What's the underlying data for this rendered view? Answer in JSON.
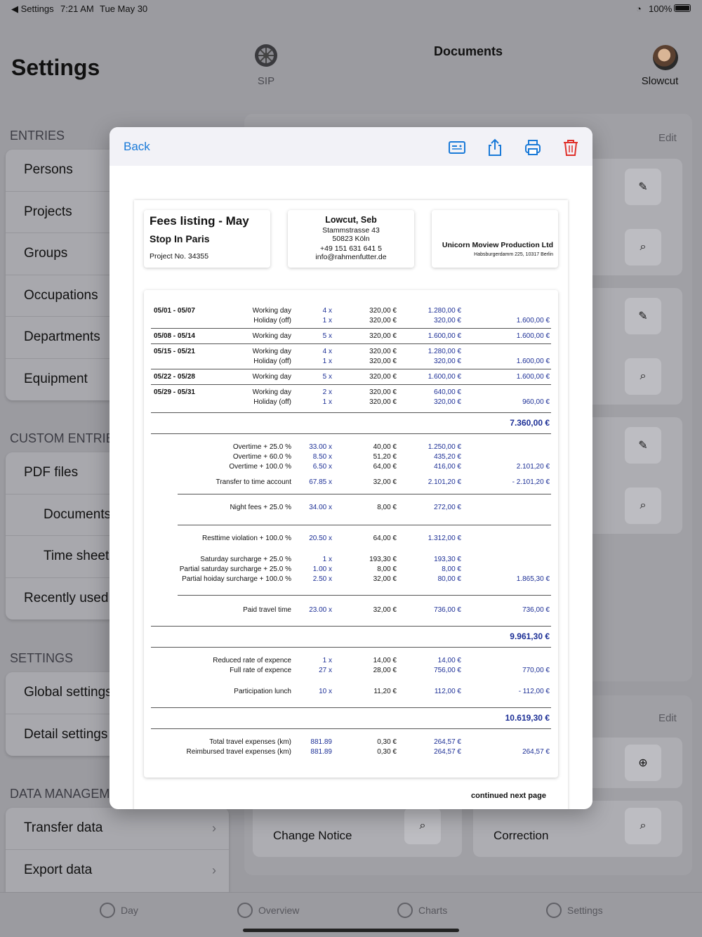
{
  "status": {
    "back_app": "◀ Settings",
    "time": "7:21 AM",
    "date": "Tue May 30",
    "battery": "100%"
  },
  "sidebar": {
    "title": "Settings",
    "sections": [
      {
        "header": "ENTRIES",
        "items": [
          "Persons",
          "Projects",
          "Groups",
          "Occupations",
          "Departments",
          "Equipment"
        ]
      },
      {
        "header": "CUSTOM ENTRIES",
        "items": [
          "PDF files",
          "Documents",
          "Time sheets",
          "Recently used"
        ]
      },
      {
        "header": "SETTINGS",
        "items": [
          "Global settings",
          "Detail settings"
        ]
      },
      {
        "header": "DATA MANAGEMEN",
        "items": [
          "Transfer data",
          "Export data"
        ]
      }
    ]
  },
  "header": {
    "project_label": "SIP",
    "title": "Documents",
    "user_label": "Slowcut"
  },
  "background": {
    "edit1": "Edit",
    "edit2": "Edit",
    "card_change": "Change Notice",
    "card_correction": "Correction"
  },
  "tabbar": {
    "day": "Day",
    "overview": "Overview",
    "charts": "Charts",
    "settings": "Settings"
  },
  "modal": {
    "back": "Back",
    "doc": {
      "title": "Fees listing - May",
      "project": "Stop In Paris",
      "project_no": "Project No. 34355",
      "person_name": "Lowcut, Seb",
      "person_street": "Stammstrasse 43",
      "person_city": "50823 Köln",
      "person_phone": "+49 151 631 641 5",
      "person_email": "info@rahmenfutter.de",
      "company": "Unicorn Moview Production Ltd",
      "company_addr": "Habsburgerdamm 225, 10317 Berlin",
      "weeks": [
        {
          "period": "05/01 - 05/07",
          "lines": [
            [
              "Working day",
              "4 x",
              "320,00 €",
              "1.280,00 €",
              ""
            ],
            [
              "Holiday (off)",
              "1 x",
              "320,00 €",
              "320,00 €",
              "1.600,00 €"
            ]
          ]
        },
        {
          "period": "05/08 - 05/14",
          "lines": [
            [
              "Working day",
              "5 x",
              "320,00 €",
              "1.600,00 €",
              "1.600,00 €"
            ]
          ]
        },
        {
          "period": "05/15 - 05/21",
          "lines": [
            [
              "Working day",
              "4 x",
              "320,00 €",
              "1.280,00 €",
              ""
            ],
            [
              "Holiday (off)",
              "1 x",
              "320,00 €",
              "320,00 €",
              "1.600,00 €"
            ]
          ]
        },
        {
          "period": "05/22 - 05/28",
          "lines": [
            [
              "Working day",
              "5 x",
              "320,00 €",
              "1.600,00 €",
              "1.600,00 €"
            ]
          ]
        },
        {
          "period": "05/29 - 05/31",
          "lines": [
            [
              "Working day",
              "2 x",
              "320,00 €",
              "640,00 €",
              ""
            ],
            [
              "Holiday (off)",
              "1 x",
              "320,00 €",
              "320,00 €",
              "960,00 €"
            ]
          ]
        }
      ],
      "subtotal1": "7.360,00 €",
      "extras": [
        [
          "Overtime + 25.0 %",
          "33.00 x",
          "40,00 €",
          "1.250,00 €",
          ""
        ],
        [
          "Overtime + 60.0 %",
          "8.50 x",
          "51,20 €",
          "435,20 €",
          ""
        ],
        [
          "Overtime + 100.0 %",
          "6.50 x",
          "64,00 €",
          "416,00 €",
          "2.101,20 €"
        ],
        [
          "Transfer to time account",
          "67.85 x",
          "32,00 €",
          "2.101,20 €",
          "- 2.101,20 €"
        ],
        [
          "Night fees + 25.0 %",
          "34.00 x",
          "8,00 €",
          "272,00 €",
          ""
        ],
        [
          "Resttime violation + 100.0 %",
          "20.50 x",
          "64,00 €",
          "1.312,00 €",
          ""
        ],
        [
          "Saturday surcharge + 25.0 %",
          "1 x",
          "193,30 €",
          "193,30 €",
          ""
        ],
        [
          "Partial saturday surcharge + 25.0 %",
          "1.00 x",
          "8,00 €",
          "8,00 €",
          ""
        ],
        [
          "Partial hoiday surcharge + 100.0 %",
          "2.50 x",
          "32,00 €",
          "80,00 €",
          "1.865,30 €"
        ],
        [
          "Paid travel time",
          "23.00 x",
          "32,00 €",
          "736,00 €",
          "736,00 €"
        ]
      ],
      "subtotal2": "9.961,30 €",
      "expences": [
        [
          "Reduced rate of expence",
          "1 x",
          "14,00 €",
          "14,00 €",
          ""
        ],
        [
          "Full rate of expence",
          "27 x",
          "28,00 €",
          "756,00 €",
          "770,00 €"
        ],
        [
          "Participation lunch",
          "10 x",
          "11,20 €",
          "112,00 €",
          "- 112,00 €"
        ]
      ],
      "subtotal3": "10.619,30 €",
      "travel": [
        [
          "Total travel expenses (km)",
          "881.89",
          "0,30 €",
          "264,57 €",
          ""
        ],
        [
          "Reimbursed travel expenses  (km)",
          "881.89",
          "0,30 €",
          "264,57 €",
          "264,57 €"
        ]
      ],
      "continued": "continued next page"
    }
  }
}
